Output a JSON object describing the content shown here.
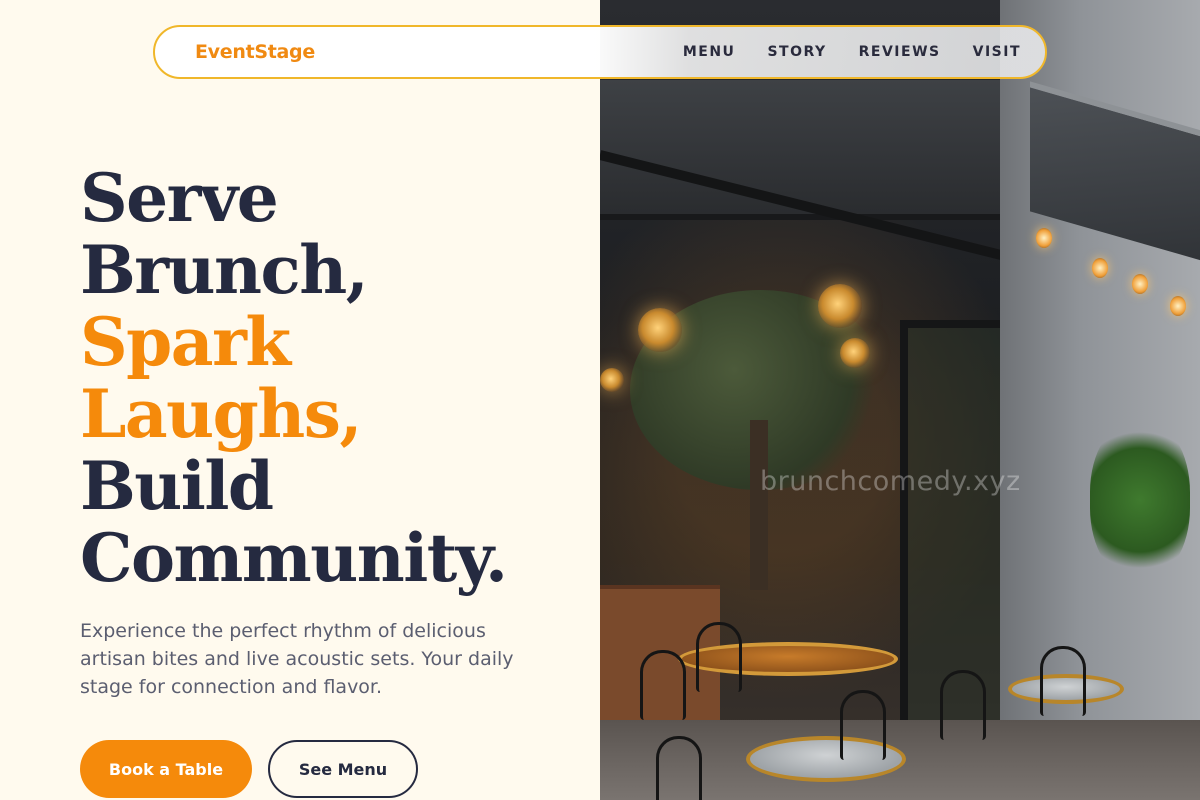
{
  "brand": {
    "name": "EventStage",
    "color": "#f08a12"
  },
  "nav": {
    "links": [
      {
        "label": "MENU"
      },
      {
        "label": "STORY"
      },
      {
        "label": "REVIEWS"
      },
      {
        "label": "VISIT"
      }
    ]
  },
  "hero": {
    "headline": {
      "line1": "Serve",
      "line2": "Brunch,",
      "line3": "Spark",
      "line4": "Laughs,",
      "line5": "Build",
      "line6": "Community."
    },
    "subtext": "Experience the perfect rhythm of delicious artisan bites and live acoustic sets. Your daily stage for connection and flavor.",
    "primary_button": "Book a Table",
    "secondary_button": "See Menu"
  },
  "image": {
    "watermark": "brunchcomedy.xyz",
    "subject": "restaurant-patio-photo"
  },
  "colors": {
    "accent": "#f58a0b",
    "text_dark": "#252a40",
    "background": "#fffaee",
    "nav_border": "#f0b72a"
  }
}
